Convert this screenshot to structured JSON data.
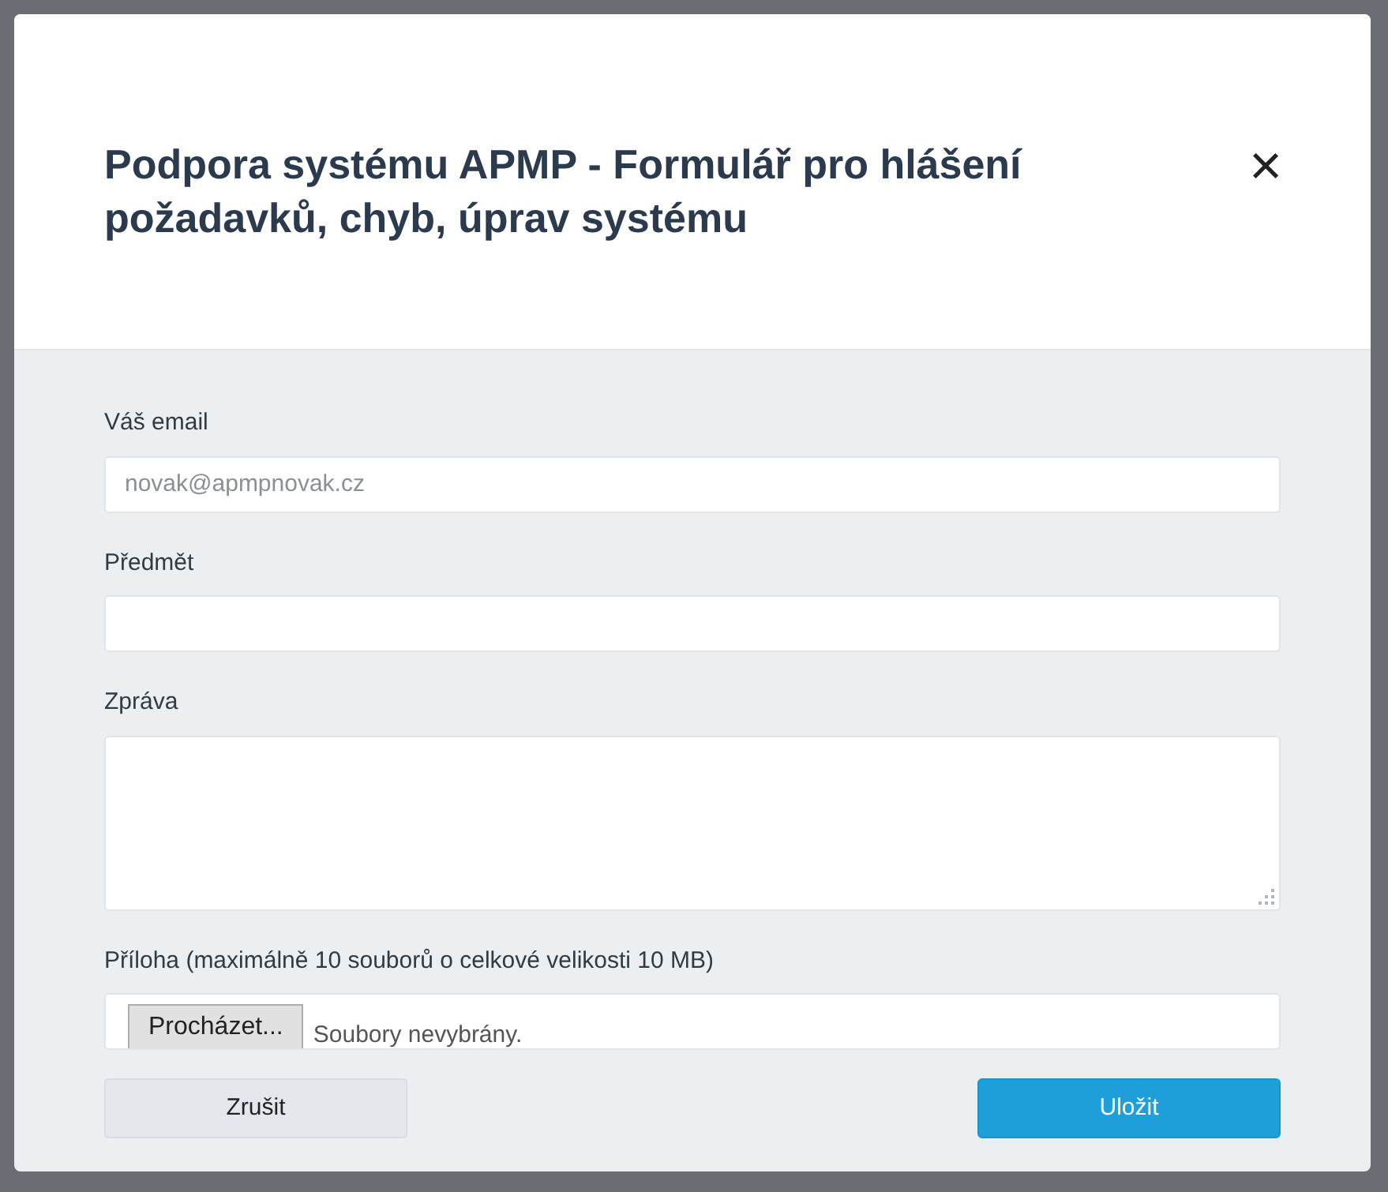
{
  "dialog": {
    "title": "Podpora systému APMP - Formulář pro hlášení požadavků, chyb, úprav systému",
    "close": "×"
  },
  "fields": [
    {
      "kind": "text",
      "label": "Váš email",
      "placeholder": "novak@apmpnovak.cz"
    },
    {
      "kind": "text",
      "label": "Předmět"
    },
    {
      "kind": "textarea",
      "label": "Zpráva"
    },
    {
      "kind": "file",
      "label": "Příloha (maximálně 10 souborů o celkové velikosti 10 MB)",
      "button": "Procházet...",
      "status": "Soubory nevybrány."
    }
  ],
  "buttons": [
    {
      "kind": "secondary",
      "label": "Zrušit"
    },
    {
      "kind": "primary",
      "label": "Uložit"
    }
  ]
}
